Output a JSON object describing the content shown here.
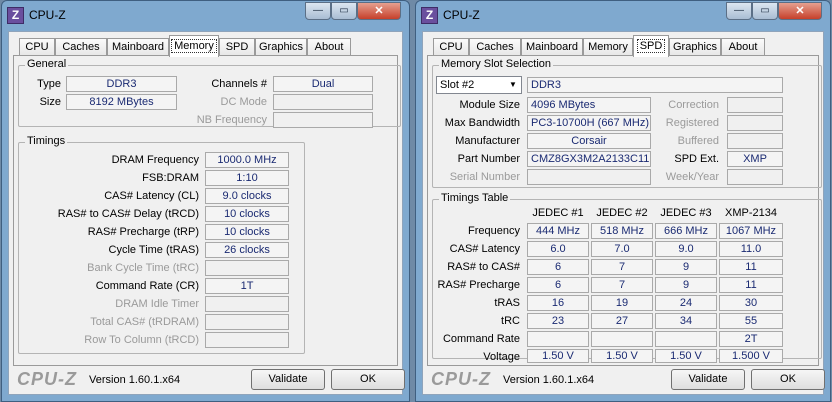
{
  "app": {
    "title": "CPU-Z",
    "icon_letter": "Z",
    "brand": "CPU-Z",
    "version": "Version 1.60.1.x64",
    "validate_label": "Validate",
    "ok_label": "OK",
    "min_glyph": "—",
    "max_glyph": "▭",
    "close_glyph": "✕"
  },
  "tabs": [
    "CPU",
    "Caches",
    "Mainboard",
    "Memory",
    "SPD",
    "Graphics",
    "About"
  ],
  "memory": {
    "general": {
      "legend": "General",
      "type_label": "Type",
      "type_value": "DDR3",
      "size_label": "Size",
      "size_value": "8192 MBytes",
      "channels_label": "Channels #",
      "channels_value": "Dual",
      "dc_mode_label": "DC Mode",
      "dc_mode_value": "",
      "nb_freq_label": "NB Frequency",
      "nb_freq_value": ""
    },
    "timings": {
      "legend": "Timings",
      "rows": [
        {
          "label": "DRAM Frequency",
          "value": "1000.0 MHz",
          "enabled": true
        },
        {
          "label": "FSB:DRAM",
          "value": "1:10",
          "enabled": true
        },
        {
          "label": "CAS# Latency (CL)",
          "value": "9.0 clocks",
          "enabled": true
        },
        {
          "label": "RAS# to CAS# Delay (tRCD)",
          "value": "10 clocks",
          "enabled": true
        },
        {
          "label": "RAS# Precharge (tRP)",
          "value": "10 clocks",
          "enabled": true
        },
        {
          "label": "Cycle Time (tRAS)",
          "value": "26 clocks",
          "enabled": true
        },
        {
          "label": "Bank Cycle Time (tRC)",
          "value": "",
          "enabled": false
        },
        {
          "label": "Command Rate (CR)",
          "value": "1T",
          "enabled": true
        },
        {
          "label": "DRAM Idle Timer",
          "value": "",
          "enabled": false
        },
        {
          "label": "Total CAS# (tRDRAM)",
          "value": "",
          "enabled": false
        },
        {
          "label": "Row To Column (tRCD)",
          "value": "",
          "enabled": false
        }
      ]
    }
  },
  "spd": {
    "slot_legend": "Memory Slot Selection",
    "slot_selected": "Slot #2",
    "slot_type": "DDR3",
    "module_size_label": "Module Size",
    "module_size": "4096 MBytes",
    "max_bw_label": "Max Bandwidth",
    "max_bw": "PC3-10700H (667 MHz)",
    "manufacturer_label": "Manufacturer",
    "manufacturer": "Corsair",
    "part_label": "Part Number",
    "part": "CMZ8GX3M2A2133C11",
    "serial_label": "Serial Number",
    "serial": "",
    "correction_label": "Correction",
    "correction": "",
    "registered_label": "Registered",
    "registered": "",
    "buffered_label": "Buffered",
    "buffered": "",
    "spd_ext_label": "SPD Ext.",
    "spd_ext": "XMP",
    "week_year_label": "Week/Year",
    "week_year": "",
    "timings_legend": "Timings Table",
    "columns": [
      "JEDEC #1",
      "JEDEC #2",
      "JEDEC #3",
      "XMP-2134"
    ],
    "rows": [
      {
        "label": "Frequency",
        "values": [
          "444 MHz",
          "518 MHz",
          "666 MHz",
          "1067 MHz"
        ]
      },
      {
        "label": "CAS# Latency",
        "values": [
          "6.0",
          "7.0",
          "9.0",
          "11.0"
        ]
      },
      {
        "label": "RAS# to CAS#",
        "values": [
          "6",
          "7",
          "9",
          "11"
        ]
      },
      {
        "label": "RAS# Precharge",
        "values": [
          "6",
          "7",
          "9",
          "11"
        ]
      },
      {
        "label": "tRAS",
        "values": [
          "16",
          "19",
          "24",
          "30"
        ]
      },
      {
        "label": "tRC",
        "values": [
          "23",
          "27",
          "34",
          "55"
        ]
      },
      {
        "label": "Command Rate",
        "values": [
          "",
          "",
          "",
          "2T"
        ]
      },
      {
        "label": "Voltage",
        "values": [
          "1.50 V",
          "1.50 V",
          "1.50 V",
          "1.500 V"
        ]
      }
    ]
  }
}
